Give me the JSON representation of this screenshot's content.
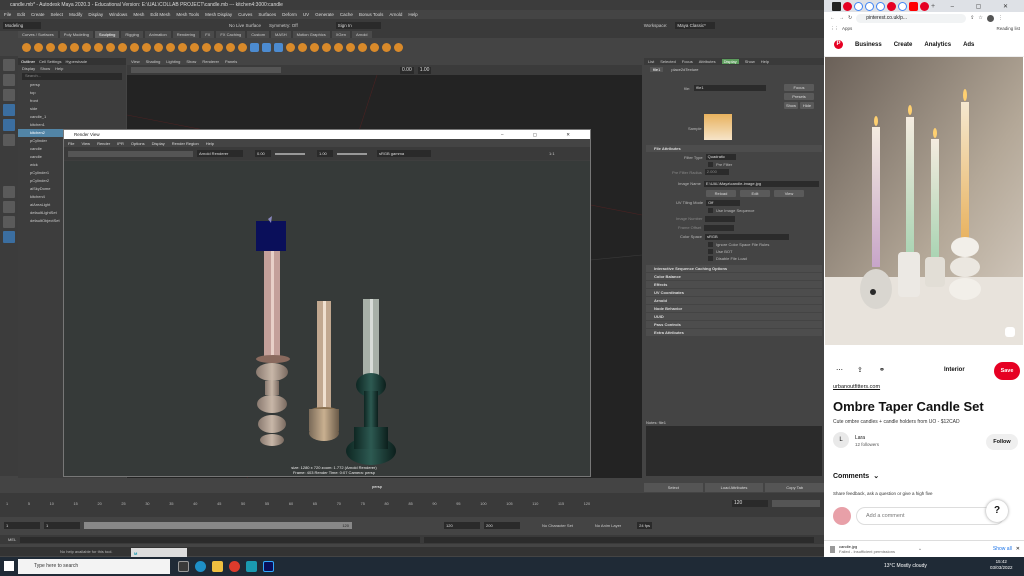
{
  "maya": {
    "window_title": "candle.mb* - Autodesk Maya 2020.3 - Educational Version: E:\\UAL\\COLLAB PROJECT\\candle.mb --- kitchen4:3000:candle",
    "menus": [
      "File",
      "Edit",
      "Create",
      "Select",
      "Modify",
      "Display",
      "Windows",
      "Mesh",
      "Edit Mesh",
      "Mesh Tools",
      "Mesh Display",
      "Curves",
      "Surfaces",
      "Deform",
      "UV",
      "Generate",
      "Cache",
      "Bonus Tools",
      "Arnold",
      "Help"
    ],
    "status_line": {
      "mode": "Modeling",
      "no_live_surface": "No Live Surface",
      "symmetry": "Symmetry: Off",
      "sign_in": "Sign In",
      "workspace_label": "Workspace:",
      "workspace": "Maya Classic*"
    },
    "shelf_tabs": [
      "Curves / Surfaces",
      "Poly Modeling",
      "Sculpting",
      "Rigging",
      "Animation",
      "Rendering",
      "FX",
      "FX Caching",
      "Custom",
      "MASH",
      "Motion Graphics",
      "XGen",
      "Arnold"
    ],
    "active_shelf_tab": "Sculpting",
    "outliner": {
      "tabs": [
        "Outliner",
        "Cell Settings",
        "Hypershade"
      ],
      "menus": [
        "Display",
        "Show",
        "Help"
      ],
      "search_placeholder": "Search...",
      "items": [
        "persp",
        "top",
        "front",
        "side",
        "candle_1",
        "kitchen1",
        "kitchen2",
        "pCylinder",
        "candle",
        "candle",
        "wick",
        "pCylinder1",
        "pCylinder2",
        "aiSkyDome",
        "kitchen4",
        "aiAreaLight",
        "defaultLightSet",
        "defaultObjectSet"
      ],
      "selected_index": 6
    },
    "viewport": {
      "menus": [
        "View",
        "Shading",
        "Lighting",
        "Show",
        "Renderer",
        "Panels"
      ],
      "camera_label": "persp",
      "exposure": "0.00",
      "gamma": "1.00"
    },
    "attribute_editor": {
      "menus": [
        "List",
        "Selected",
        "Focus",
        "Attributes",
        "Display",
        "Show",
        "Help"
      ],
      "active_menu": "Display",
      "tab": "file1",
      "tab2": "place2dTexture",
      "file_label": "file:",
      "file_value": "file1",
      "focus_btn": "Focus",
      "presets_btn": "Presets",
      "show_btn": "Show",
      "hide_btn": "Hide",
      "sample_label": "Sample",
      "sections": [
        "File Attributes",
        "Interactive Sequence Caching Options",
        "Color Balance",
        "Effects",
        "UV Coordinates",
        "Arnold",
        "Node Behavior",
        "UUID",
        "Pass Controls",
        "Extra Attributes"
      ],
      "filter_type_label": "Filter Type",
      "filter_type": "Quadratic",
      "pre_filter": "Pre Filter",
      "pre_filter_radius_label": "Pre Filter Radius",
      "pre_filter_radius": "2.000",
      "image_name_label": "Image Name",
      "image_name": "E:\\UAL\\Maya\\candle-image.jpg",
      "reload": "Reload",
      "edit": "Edit",
      "view": "View",
      "uv_tiling_label": "UV Tiling Mode",
      "uv_tiling": "Off",
      "use_image_sequence": "Use Image Sequence",
      "image_number_label": "Image Number",
      "frame_offset_label": "Frame Offset",
      "color_space_label": "Color Space",
      "color_space": "sRGB",
      "ignore_cs": "Ignore Color Space File Rules",
      "use_bot": "Use BOT",
      "disable_file_load": "Disable File Load",
      "notes_label": "Notes: file1",
      "bottom_buttons": [
        "Select",
        "Load Attributes",
        "Copy Tab"
      ]
    },
    "time_slider": {
      "ticks": [
        "1",
        "5",
        "10",
        "15",
        "20",
        "25",
        "30",
        "35",
        "40",
        "45",
        "50",
        "55",
        "60",
        "65",
        "70",
        "75",
        "80",
        "85",
        "90",
        "95",
        "100",
        "105",
        "110",
        "115",
        "120"
      ],
      "current": "120"
    },
    "range_slider": {
      "start": "1",
      "start2": "1",
      "end": "120",
      "end2": "120",
      "end3": "200",
      "no_char_set": "No Character Set",
      "no_anim_layer": "No Anim Layer",
      "fps": "24 fps"
    },
    "cmd": {
      "mel": "MEL"
    },
    "help_line": "No help available for this tool.",
    "mini_window": "M"
  },
  "render_view": {
    "title": "Render View",
    "menus": [
      "File",
      "View",
      "Render",
      "IPR",
      "Options",
      "Display",
      "Render Region",
      "Help"
    ],
    "renderer": "Arnold Renderer",
    "exposure": "0.00",
    "gamma": "1.00",
    "color_mode": "sRGB gamma",
    "zoom": "1:1",
    "info_line1": "size: 1280 x 720 zoom: 1.772     (Arnold Renderer)",
    "info_line2": "Frame: 403       Render Time: 0:07       Camera: persp"
  },
  "browser": {
    "url": "pinterest.co.uk/p...",
    "apps": "Apps",
    "reading_list": "Reading list",
    "nav": [
      "Business",
      "Create",
      "Analytics",
      "Ads"
    ],
    "board": "Interior",
    "save": "Save",
    "source": "urbanoutfitters.com",
    "title": "Ombre Taper Candle Set",
    "description": "Cute ombre candles + candle holders from UO - $12CAD",
    "user": "Lara",
    "user_initial": "L",
    "followers": "12 followers",
    "follow": "Follow",
    "comments": "Comments",
    "comments_hint": "Share feedback, ask a question or give a high five",
    "add_comment": "Add a comment",
    "help": "?",
    "download_file": "candle.jpg",
    "download_status": "Failed - Insufficient permissions",
    "show_all": "Show all"
  },
  "taskbar": {
    "search": "Type here to search",
    "weather": "13°C  Mostly cloudy",
    "time": "15:42",
    "date": "03/03/2022"
  }
}
